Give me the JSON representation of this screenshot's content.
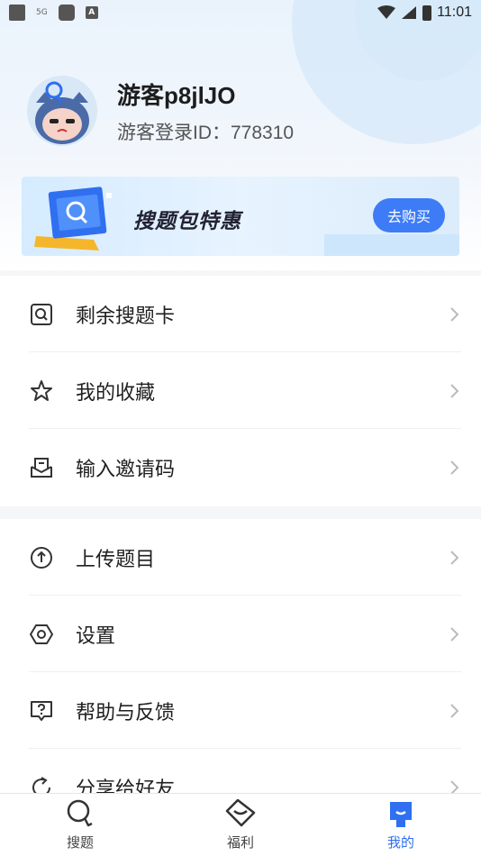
{
  "status_bar": {
    "network": "5G",
    "time": "11:01"
  },
  "user": {
    "name": "游客p8jlJO",
    "id_line": "游客登录ID：778310"
  },
  "banner": {
    "title": "搜题包特惠",
    "button_label": "去购买"
  },
  "menu_group1": [
    {
      "label": "剩余搜题卡",
      "icon": "card-icon"
    },
    {
      "label": "我的收藏",
      "icon": "star-icon"
    },
    {
      "label": "输入邀请码",
      "icon": "invite-icon"
    }
  ],
  "menu_group2": [
    {
      "label": "上传题目",
      "icon": "upload-icon"
    },
    {
      "label": "设置",
      "icon": "settings-icon"
    },
    {
      "label": "帮助与反馈",
      "icon": "help-icon"
    },
    {
      "label": "分享给好友",
      "icon": "share-icon"
    }
  ],
  "tabs": [
    {
      "label": "搜题",
      "icon": "search-icon",
      "active": false
    },
    {
      "label": "福利",
      "icon": "gift-icon",
      "active": false
    },
    {
      "label": "我的",
      "icon": "profile-icon",
      "active": true
    }
  ],
  "colors": {
    "accent": "#3d7cf6",
    "tab_active": "#2f6ff0"
  }
}
